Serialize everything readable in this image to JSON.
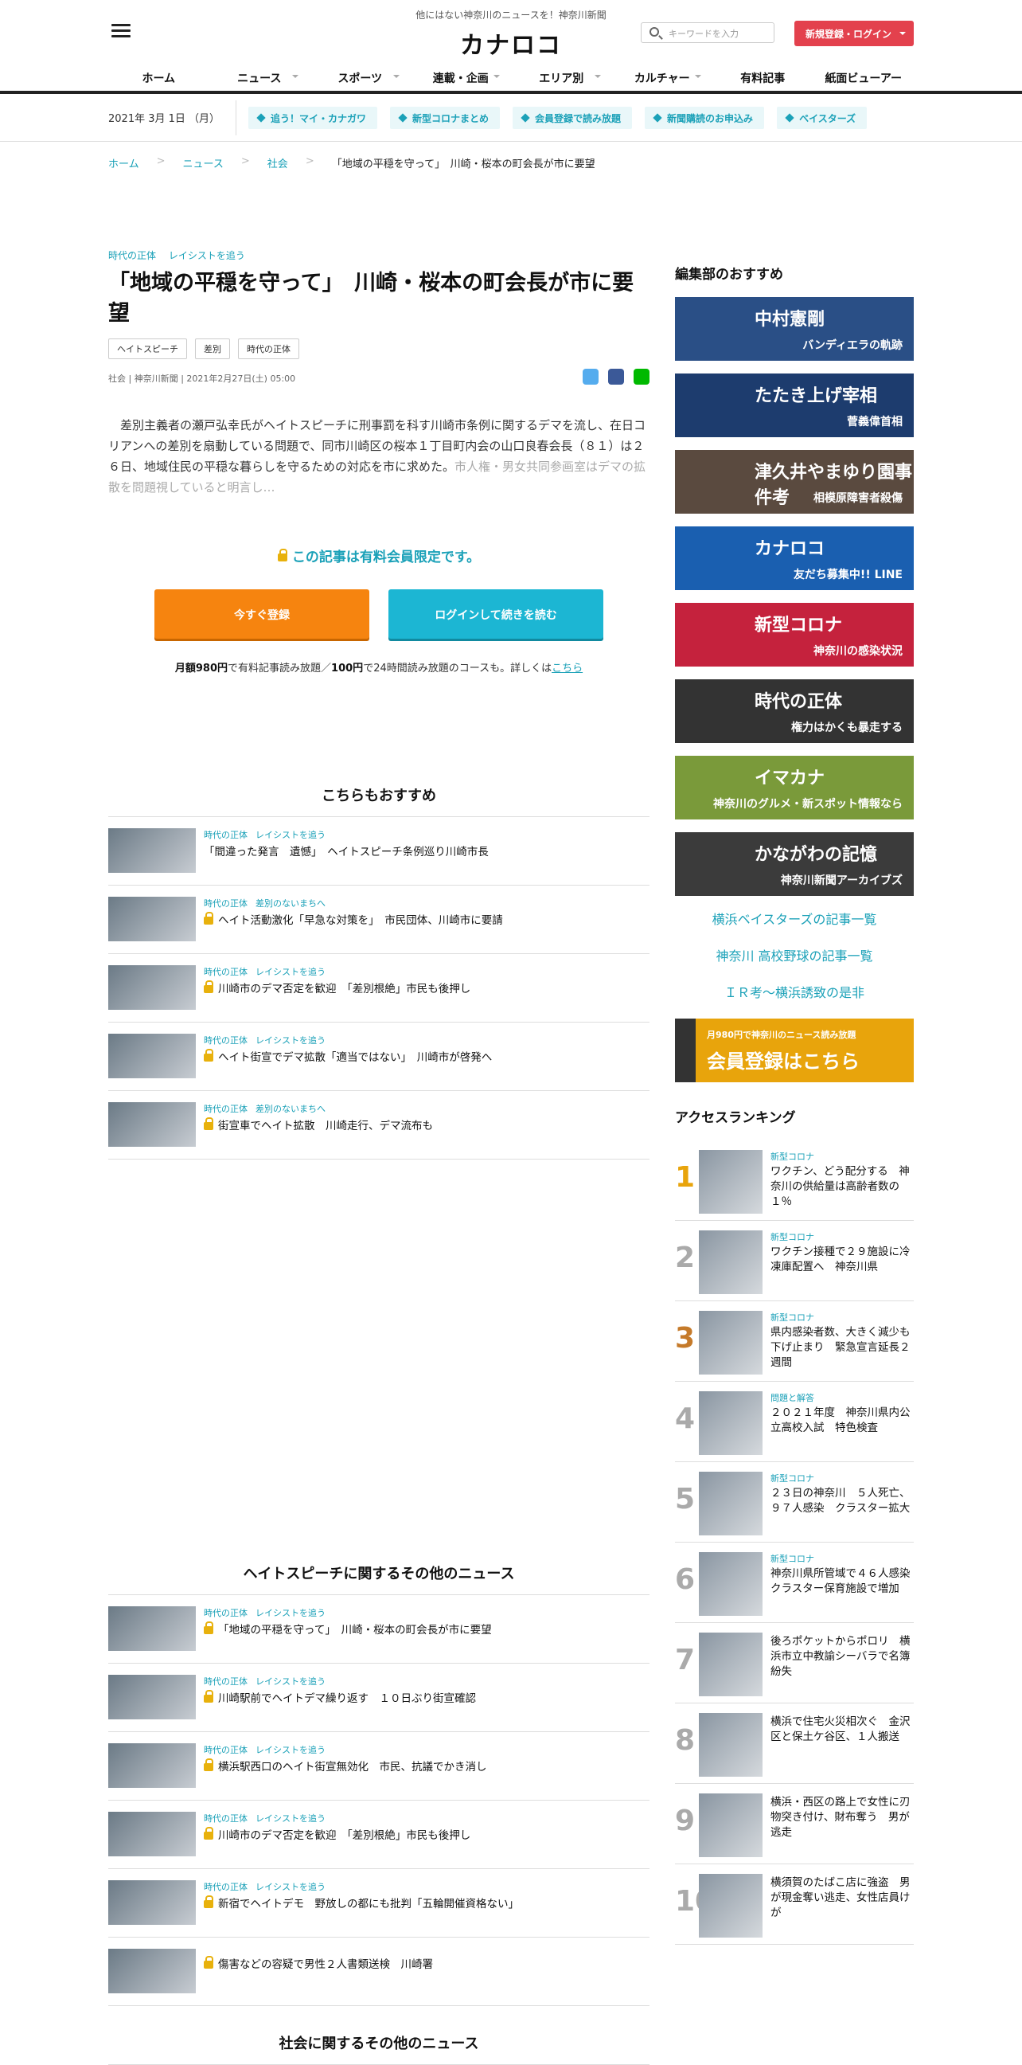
{
  "header": {
    "tagline": "他にはない神奈川のニュースを！神奈川新聞",
    "logo": "カナロコ",
    "search_placeholder": "キーワードを入力",
    "register_login": "新規登録・ログイン",
    "nav": [
      {
        "label": "ホーム",
        "dd": false
      },
      {
        "label": "ニュース",
        "dd": true
      },
      {
        "label": "スポーツ",
        "dd": true
      },
      {
        "label": "連載・企画",
        "dd": true
      },
      {
        "label": "エリア別",
        "dd": true
      },
      {
        "label": "カルチャー",
        "dd": true
      },
      {
        "label": "有料記事",
        "dd": false
      },
      {
        "label": "紙面ビューアー",
        "dd": false
      }
    ]
  },
  "subbar": {
    "date": "2021年 3月 1日 （月）",
    "tags": [
      "追う！マイ・カナガワ",
      "新型コロナまとめ",
      "会員登録で読み放題",
      "新聞購読のお申込み",
      "ベイスターズ"
    ]
  },
  "breadcrumb": [
    "ホーム",
    "ニュース",
    "社会",
    "「地域の平穏を守って」　川崎・桜本の町会長が市に要望"
  ],
  "article": {
    "cat1": "時代の正体",
    "cat2": "レイシストを追う",
    "title": "「地域の平穏を守って」　川崎・桜本の町会長が市に要望",
    "keywords": [
      "ヘイトスピーチ",
      "差別",
      "時代の正体"
    ],
    "meta": "社会 | 神奈川新聞 | 2021年2月27日(土) 05:00",
    "body": "差別主義者の瀬戸弘幸氏がヘイトスピーチに刑事罰を科す川崎市条例に関するデマを流し、在日コリアンへの差別を扇動している問題で、同市川崎区の桜本１丁目町内会の山口良春会長（８１）は２６日、地域住民の平穏な暮らしを守るための対応を市に求めた。",
    "body_fade": "市人権・男女共同参画室はデマの拡散を問題視していると明言し…",
    "paywall": "この記事は有料会員限定です。",
    "btn_register": "今すぐ登録",
    "btn_login": "ログインして続きを読む",
    "price_a": "月額980円",
    "price_b": "で有料記事読み放題／",
    "price_c": "100円",
    "price_d": "で24時間読み放題のコースも。詳しくは",
    "price_link": "こちら"
  },
  "recommend": {
    "title": "こちらもおすすめ",
    "items": [
      {
        "c1": "時代の正体",
        "c2": "レイシストを追う",
        "t": "「間違った発言　遺憾」　ヘイトスピーチ条例巡り川崎市長",
        "lock": false
      },
      {
        "c1": "時代の正体",
        "c2": "差別のないまちへ",
        "t": "ヘイト活動激化「早急な対策を」　市民団体、川崎市に要請",
        "lock": true
      },
      {
        "c1": "時代の正体",
        "c2": "レイシストを追う",
        "t": "川崎市のデマ否定を歓迎　「差別根絶」市民も後押し",
        "lock": true
      },
      {
        "c1": "時代の正体",
        "c2": "レイシストを追う",
        "t": "ヘイト街宣でデマ拡散「適当ではない」　川崎市が啓発へ",
        "lock": true
      },
      {
        "c1": "時代の正体",
        "c2": "差別のないまちへ",
        "t": "街宣車でヘイト拡散　川崎走行、デマ流布も",
        "lock": true
      }
    ]
  },
  "hate_news": {
    "title": "ヘイトスピーチに関するその他のニュース",
    "items": [
      {
        "c1": "時代の正体",
        "c2": "レイシストを追う",
        "t": "「地域の平穏を守って」　川崎・桜本の町会長が市に要望",
        "lock": true
      },
      {
        "c1": "時代の正体",
        "c2": "レイシストを追う",
        "t": "川崎駅前でヘイトデマ繰り返す　１０日ぶり街宣確認",
        "lock": true
      },
      {
        "c1": "時代の正体",
        "c2": "レイシストを追う",
        "t": "横浜駅西口のヘイト街宣無効化　市民、抗議でかき消し",
        "lock": true
      },
      {
        "c1": "時代の正体",
        "c2": "レイシストを追う",
        "t": "川崎市のデマ否定を歓迎　「差別根絶」市民も後押し",
        "lock": true
      },
      {
        "c1": "時代の正体",
        "c2": "レイシストを追う",
        "t": "新宿でヘイトデモ　野放しの都にも批判「五輪開催資格ない」",
        "lock": true
      },
      {
        "c1": "",
        "c2": "",
        "t": "傷害などの容疑で男性２人書類送検　川崎署",
        "lock": true
      }
    ]
  },
  "society_news": {
    "title": "社会に関するその他のニュース"
  },
  "sidebar": {
    "title": "編集部のおすすめ",
    "banners": [
      {
        "big": "中村憲剛",
        "sm": "バンディエラの軌跡",
        "bg": "#2a4f86"
      },
      {
        "big": "たたき上げ宰相",
        "sm": "菅義偉首相",
        "bg": "#1d3c6e"
      },
      {
        "big": "津久井やまゆり園事件考",
        "sm": "相模原障害者殺傷",
        "bg": "#5a4a3f"
      },
      {
        "big": "カナロコ",
        "sm": "友だち募集中!! LINE",
        "bg": "#1a5fb0"
      },
      {
        "big": "新型コロナ",
        "sm": "神奈川の感染状況",
        "bg": "#c5223d"
      },
      {
        "big": "時代の正体",
        "sm": "権力はかくも暴走する",
        "bg": "#333"
      },
      {
        "big": "イマカナ",
        "sm": "神奈川のグルメ・新スポット情報なら",
        "bg": "#7a9a3a"
      },
      {
        "big": "かながわの記憶",
        "sm": "神奈川新聞アーカイブズ",
        "bg": "#3b3b3b"
      }
    ],
    "links": [
      "横浜ベイスターズの記事一覧",
      "神奈川 高校野球の記事一覧",
      "ＩＲ考～横浜誘致の是非"
    ],
    "member_banner": {
      "small": "月980円で神奈川のニュース読み放題",
      "big": "会員登録はこちら"
    }
  },
  "ranking": {
    "title": "アクセスランキング",
    "items": [
      {
        "n": "1",
        "c": "新型コロナ",
        "t": "ワクチン、どう配分する　神奈川の供給量は高齢者数の１％"
      },
      {
        "n": "2",
        "c": "新型コロナ",
        "t": "ワクチン接種で２９施設に冷凍庫配置へ　神奈川県"
      },
      {
        "n": "3",
        "c": "新型コロナ",
        "t": "県内感染者数、大きく減少も下げ止まり　緊急宣言延長２週間"
      },
      {
        "n": "4",
        "c": "問題と解答",
        "t": "２０２１年度　神奈川県内公立高校入試　特色検査"
      },
      {
        "n": "5",
        "c": "新型コロナ",
        "t": "２３日の神奈川　５人死亡、９７人感染　クラスター拡大"
      },
      {
        "n": "6",
        "c": "新型コロナ",
        "t": "神奈川県所管域で４６人感染　クラスター保育施設で増加"
      },
      {
        "n": "7",
        "c": "",
        "t": "後ろポケットからポロリ　横浜市立中教諭シーバラで名簿紛失"
      },
      {
        "n": "8",
        "c": "",
        "t": "横浜で住宅火災相次ぐ　金沢区と保土ケ谷区、１人搬送"
      },
      {
        "n": "9",
        "c": "",
        "t": "横浜・西区の路上で女性に刃物突き付け、財布奪う　男が逃走"
      },
      {
        "n": "10",
        "c": "",
        "t": "横須賀のたばこ店に強盗　男が現金奪い逃走、女性店員けが"
      }
    ]
  }
}
